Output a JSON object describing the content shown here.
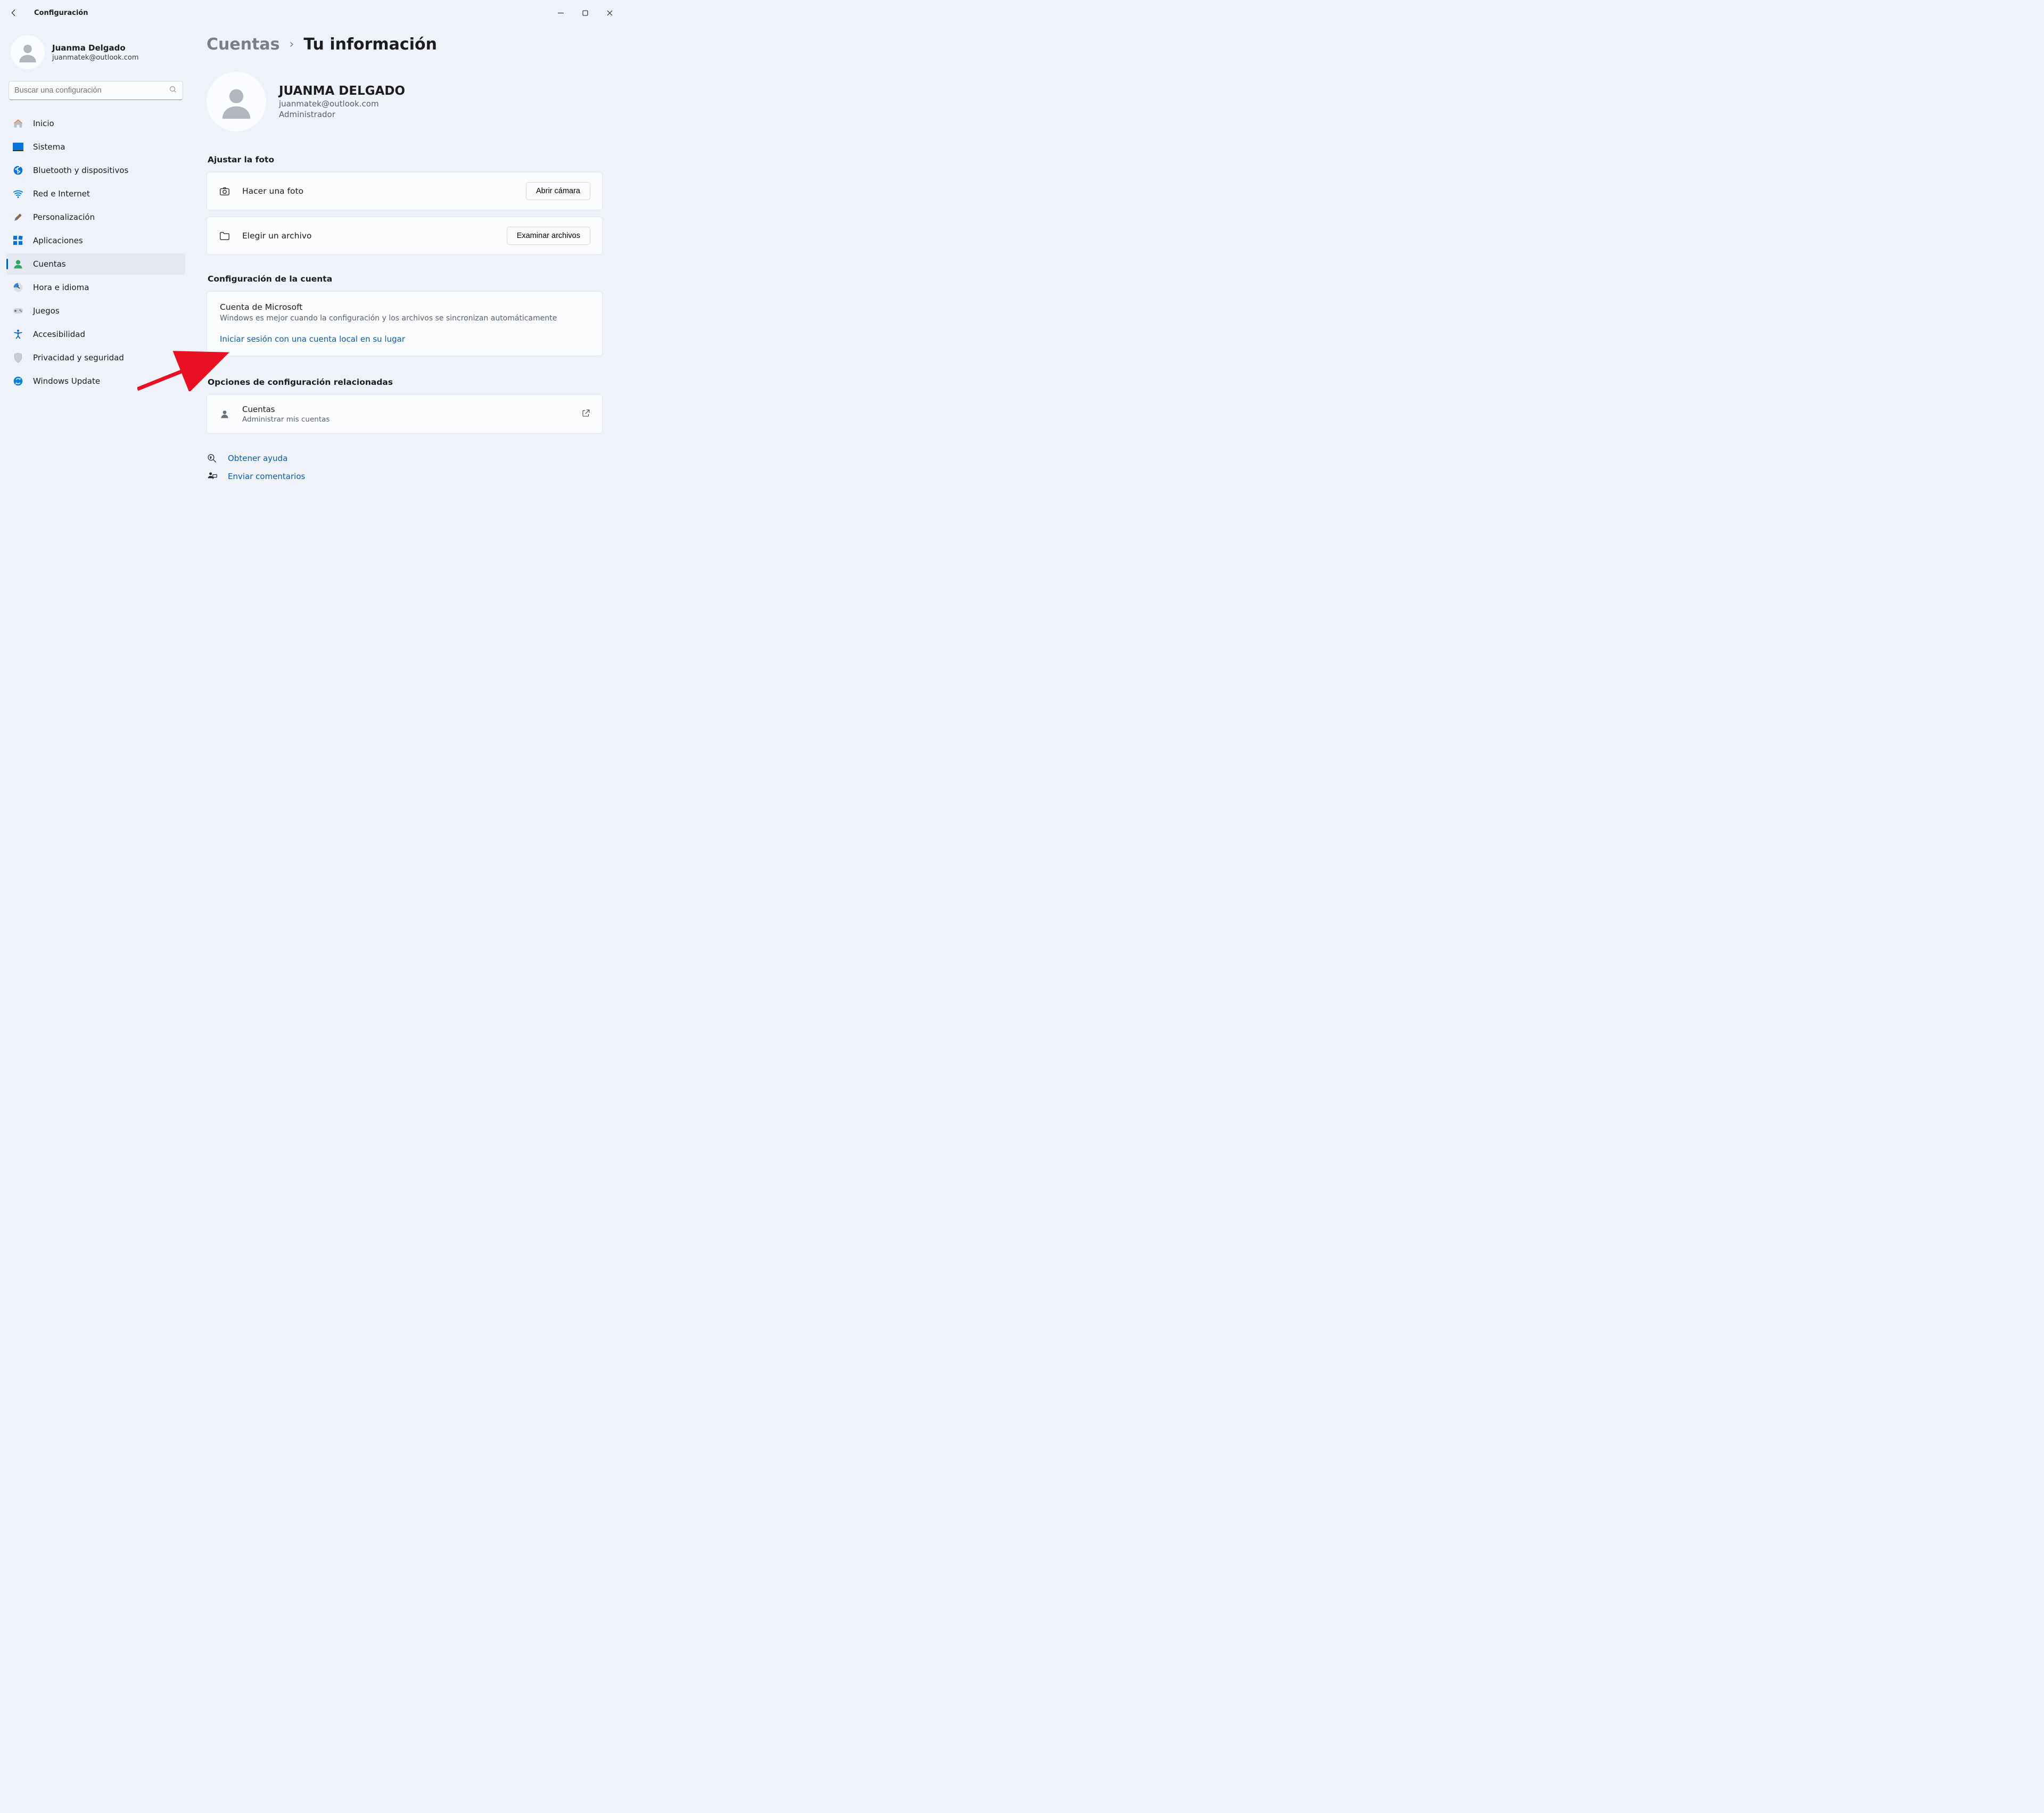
{
  "app_title": "Configuración",
  "sidebar_user": {
    "name": "Juanma Delgado",
    "email": "juanmatek@outlook.com"
  },
  "search": {
    "placeholder": "Buscar una configuración"
  },
  "nav": [
    {
      "key": "home",
      "label": "Inicio"
    },
    {
      "key": "system",
      "label": "Sistema"
    },
    {
      "key": "bluetooth",
      "label": "Bluetooth y dispositivos"
    },
    {
      "key": "network",
      "label": "Red e Internet"
    },
    {
      "key": "personalization",
      "label": "Personalización"
    },
    {
      "key": "apps",
      "label": "Aplicaciones"
    },
    {
      "key": "accounts",
      "label": "Cuentas",
      "active": true
    },
    {
      "key": "time",
      "label": "Hora e idioma"
    },
    {
      "key": "gaming",
      "label": "Juegos"
    },
    {
      "key": "accessibility",
      "label": "Accesibilidad"
    },
    {
      "key": "privacy",
      "label": "Privacidad y seguridad"
    },
    {
      "key": "update",
      "label": "Windows Update"
    }
  ],
  "breadcrumb": {
    "parent": "Cuentas",
    "current": "Tu información"
  },
  "profile": {
    "name": "JUANMA DELGADO",
    "email": "juanmatek@outlook.com",
    "role": "Administrador"
  },
  "adjust_photo": {
    "title": "Ajustar la foto",
    "take_photo": "Hacer una foto",
    "open_camera": "Abrir cámara",
    "choose_file": "Elegir un archivo",
    "browse_files": "Examinar archivos"
  },
  "account_settings": {
    "title": "Configuración de la cuenta",
    "ms_account": "Cuenta de Microsoft",
    "ms_desc": "Windows es mejor cuando la configuración y los archivos se sincronizan automáticamente",
    "local_link": "Iniciar sesión con una cuenta local en su lugar"
  },
  "related": {
    "title": "Opciones de configuración relacionadas",
    "accounts": "Cuentas",
    "manage": "Administrar mis cuentas"
  },
  "help": {
    "get_help": "Obtener ayuda",
    "feedback": "Enviar comentarios"
  }
}
